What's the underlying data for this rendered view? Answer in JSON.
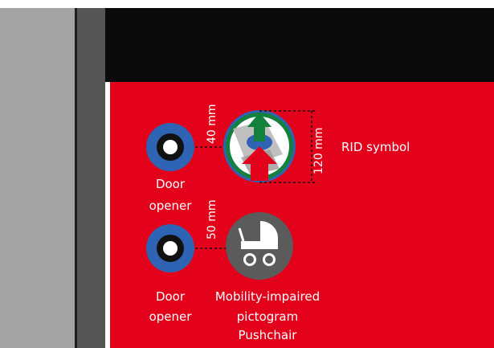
{
  "colors": {
    "background": "#ffffff",
    "wall": "#a3a3a3",
    "frame": "#555555",
    "header": "#0a0a0a",
    "panel": "#e3001b",
    "button_ring": "#2f63b3",
    "pictogram_bg": "#5b5b5b",
    "rid_ring": "#2f63b3",
    "rid_green": "#13813d",
    "rid_red": "#e3001b"
  },
  "icons": {
    "door_opener_button": "ring-button-icon",
    "rid_symbol": "rid-symbol-icon",
    "pushchair": "pushchair-icon"
  },
  "labels": {
    "dim_40": "40 mm",
    "dim_120": "120 mm",
    "dim_50": "50 mm",
    "rid_symbol": "RID symbol",
    "door_opener_1_line1": "Door",
    "door_opener_1_line2": "opener",
    "door_opener_2_line1": "Door",
    "door_opener_2_line2": "opener",
    "pictogram_line1": "Mobility-impaired",
    "pictogram_line2": "pictogram",
    "pictogram_line3": "Pushchair"
  }
}
